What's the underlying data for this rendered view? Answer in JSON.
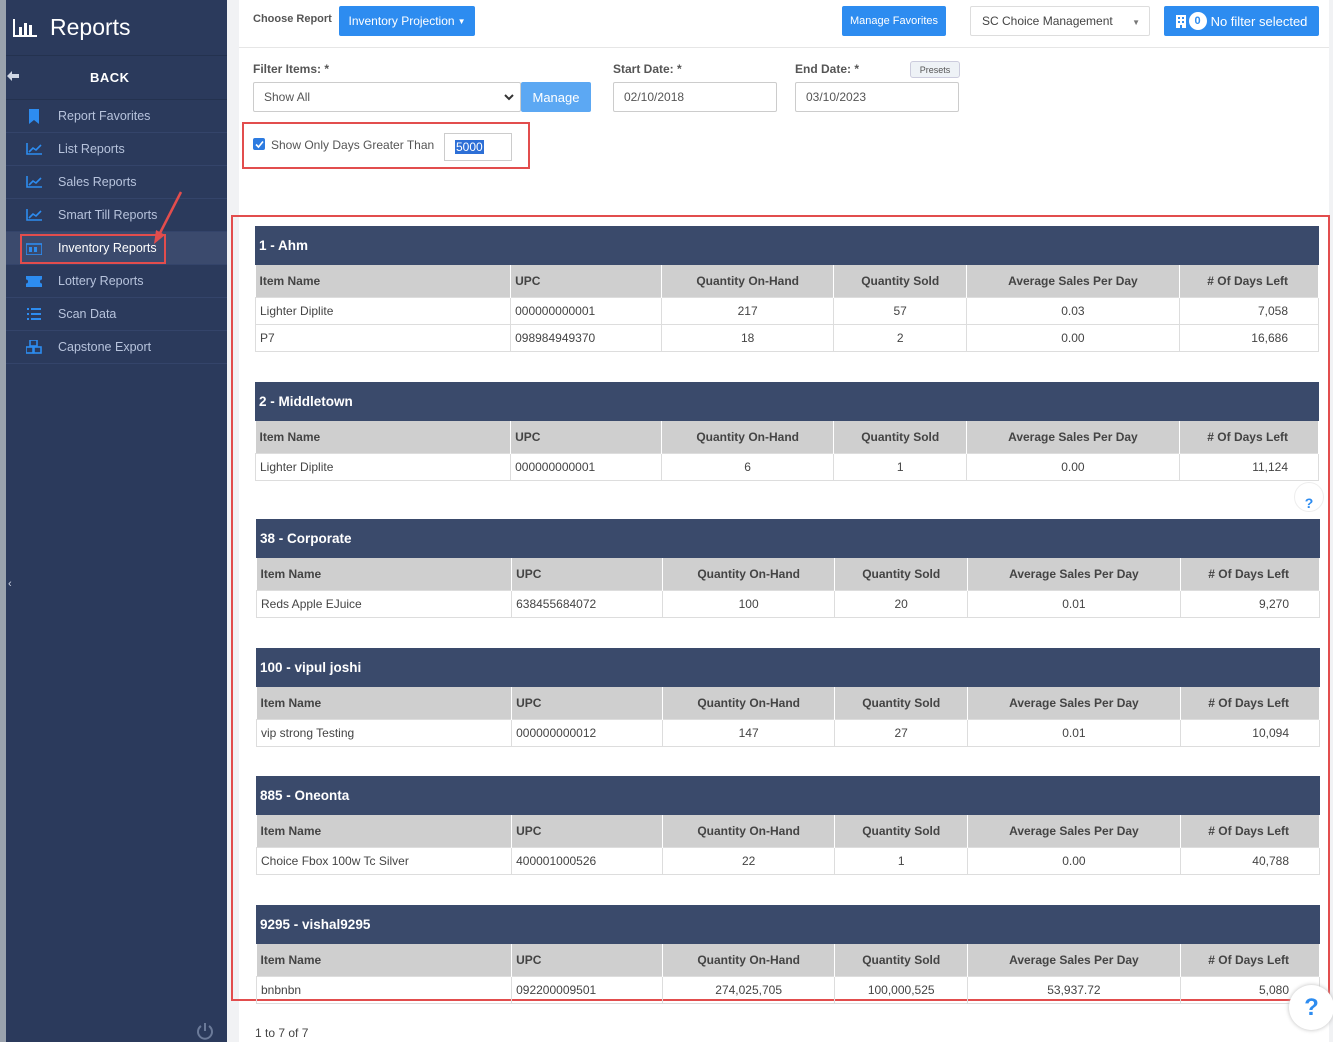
{
  "sidebar": {
    "title": "Reports",
    "back_label": "BACK",
    "items": [
      {
        "label": "Report Favorites",
        "icon": "bookmark-icon"
      },
      {
        "label": "List Reports",
        "icon": "chart-icon"
      },
      {
        "label": "Sales Reports",
        "icon": "chart-icon"
      },
      {
        "label": "Smart Till Reports",
        "icon": "chart-icon"
      },
      {
        "label": "Inventory Reports",
        "icon": "inventory-icon"
      },
      {
        "label": "Lottery Reports",
        "icon": "ticket-icon"
      },
      {
        "label": "Scan Data",
        "icon": "list-icon"
      },
      {
        "label": "Capstone Export",
        "icon": "cubes-icon"
      }
    ]
  },
  "toolbar": {
    "choose_report_label": "Choose Report",
    "report_selected": "Inventory Projection",
    "manage_favorites": "Manage Favorites",
    "store_selected": "SC Choice Management",
    "filter_count": "0",
    "filter_label": "No filter selected"
  },
  "filters": {
    "filter_items_label": "Filter Items: *",
    "filter_items_value": "Show All",
    "manage_label": "Manage",
    "start_date_label": "Start Date: *",
    "start_date": "02/10/2018",
    "end_date_label": "End Date: *",
    "end_date": "03/10/2023",
    "presets_label": "Presets",
    "days_checkbox_label": "Show Only Days Greater Than",
    "days_value": "5000"
  },
  "columns": [
    "Item Name",
    "UPC",
    "Quantity On-Hand",
    "Quantity Sold",
    "Average Sales Per Day",
    "# Of Days Left"
  ],
  "groups": [
    {
      "title": "1 - Ahm",
      "rows": [
        [
          "Lighter Diplite",
          "000000000001",
          "217",
          "57",
          "0.03",
          "7,058"
        ],
        [
          "P7",
          "098984949370",
          "18",
          "2",
          "0.00",
          "16,686"
        ]
      ]
    },
    {
      "title": "2 - Middletown",
      "rows": [
        [
          "Lighter Diplite",
          "000000000001",
          "6",
          "1",
          "0.00",
          "11,124"
        ]
      ]
    },
    {
      "title": "38 - Corporate",
      "rows": [
        [
          "Reds Apple EJuice",
          "638455684072",
          "100",
          "20",
          "0.01",
          "9,270"
        ]
      ]
    },
    {
      "title": "100 - vipul joshi",
      "rows": [
        [
          "vip strong Testing",
          "000000000012",
          "147",
          "27",
          "0.01",
          "10,094"
        ]
      ]
    },
    {
      "title": "885 - Oneonta",
      "rows": [
        [
          "Choice Fbox 100w Tc Silver",
          "400001000526",
          "22",
          "1",
          "0.00",
          "40,788"
        ]
      ]
    },
    {
      "title": "9295 - vishal9295",
      "rows": [
        [
          "bnbnbn",
          "092200009501",
          "274,025,705",
          "100,000,525",
          "53,937.72",
          "5,080"
        ]
      ]
    }
  ],
  "pager_text": "1 to 7 of 7",
  "help_label": "?"
}
